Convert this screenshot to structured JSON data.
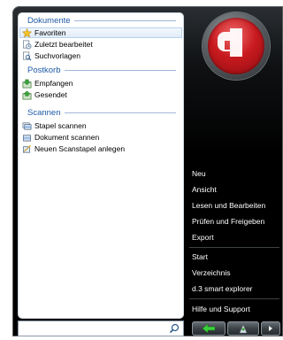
{
  "sections": [
    {
      "title": "Dokumente",
      "items": [
        {
          "label": "Favoriten",
          "icon": "star-icon",
          "selected": true
        },
        {
          "label": "Zuletzt bearbeitet",
          "icon": "recent-documents-icon"
        },
        {
          "label": "Suchvorlagen",
          "icon": "search-templates-icon"
        }
      ]
    },
    {
      "title": "Postkorb",
      "items": [
        {
          "label": "Empfangen",
          "icon": "inbox-icon"
        },
        {
          "label": "Gesendet",
          "icon": "outbox-icon"
        }
      ]
    },
    {
      "title": "Scannen",
      "items": [
        {
          "label": "Stapel scannen",
          "icon": "scan-batch-icon"
        },
        {
          "label": "Dokument scannen",
          "icon": "scan-document-icon"
        },
        {
          "label": "Neuen Scanstapel anlegen",
          "icon": "new-scan-batch-icon"
        }
      ]
    }
  ],
  "right_menu": {
    "group1": [
      "Neu",
      "Ansicht",
      "Lesen und Bearbeiten",
      "Prüfen und Freigeben",
      "Export"
    ],
    "group2": [
      "Start",
      "Verzeichnis",
      "d.3 smart explorer"
    ],
    "group3": [
      "Hilfe und Support"
    ]
  },
  "logo_letter": "d",
  "search": {
    "placeholder": ""
  },
  "colors": {
    "accent": "#1d5aa6",
    "logo_red": "#c81a1f"
  }
}
